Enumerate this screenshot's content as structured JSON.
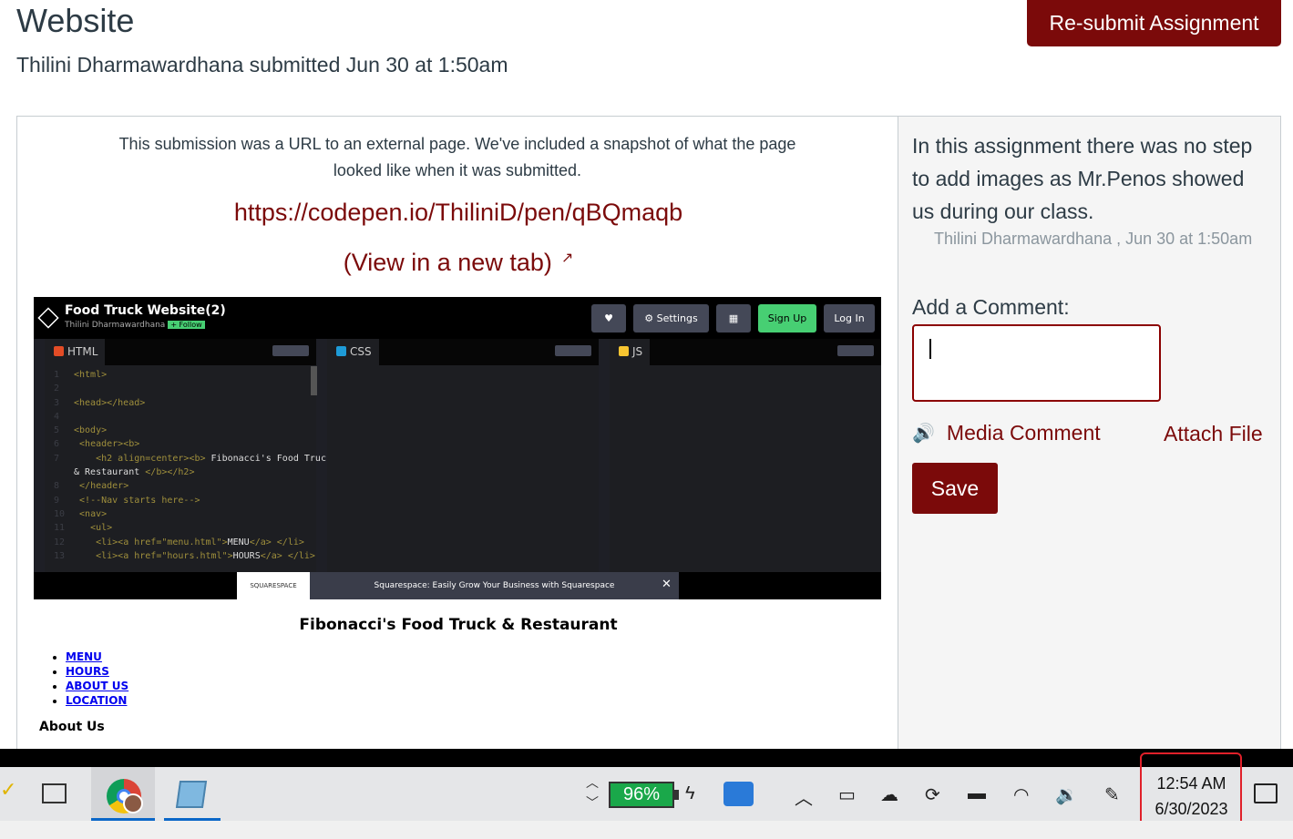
{
  "header": {
    "title": "Website",
    "submitted_line": "Thilini Dharmawardhana submitted Jun 30 at 1:50am",
    "resubmit_label": "Re-submit Assignment"
  },
  "submission": {
    "notice": "This submission was a URL to an external page. We've included a snapshot of what the page looked like when it was submitted.",
    "url": "https://codepen.io/ThiliniD/pen/qBQmaqb",
    "new_tab_label": "(View in a new tab)"
  },
  "snapshot": {
    "pen_title": "Food Truck Website(2)",
    "author": "Thilini Dharmawardhana",
    "follow_label": "+ Follow",
    "buttons": {
      "heart": "♥",
      "settings": "⚙ Settings",
      "layout": "▦",
      "signup": "Sign Up",
      "login": "Log In"
    },
    "editors": [
      {
        "name": "HTML",
        "color": "#e34c26"
      },
      {
        "name": "CSS",
        "color": "#1e9bd7"
      },
      {
        "name": "JS",
        "color": "#f7c531"
      }
    ],
    "ad_logo": "SQUARESPACE",
    "ad_text": "Squarespace: Easily Grow Your Business with Squarespace",
    "ad_close": "✕"
  },
  "rendered_site": {
    "heading": "Fibonacci's Food Truck & Restaurant",
    "nav": [
      "MENU",
      "HOURS",
      "ABOUT US",
      "LOCATION"
    ],
    "about_heading": "About Us"
  },
  "comments": {
    "text": "In this assignment there was no step to add images as Mr.Penos showed us during our class.",
    "meta": "Thilini Dharmawardhana , Jun 30 at 1:50am",
    "add_label": "Add a Comment:",
    "media_comment_label": "Media Comment",
    "attach_file_label": "Attach File",
    "save_label": "Save"
  },
  "taskbar": {
    "battery": "96%",
    "time": "12:54 AM",
    "date": "6/30/2023"
  },
  "colors": {
    "brand": "#7b0a0a",
    "text": "#2d3b45",
    "muted": "#8b969e",
    "annotation": "#e0202a"
  }
}
